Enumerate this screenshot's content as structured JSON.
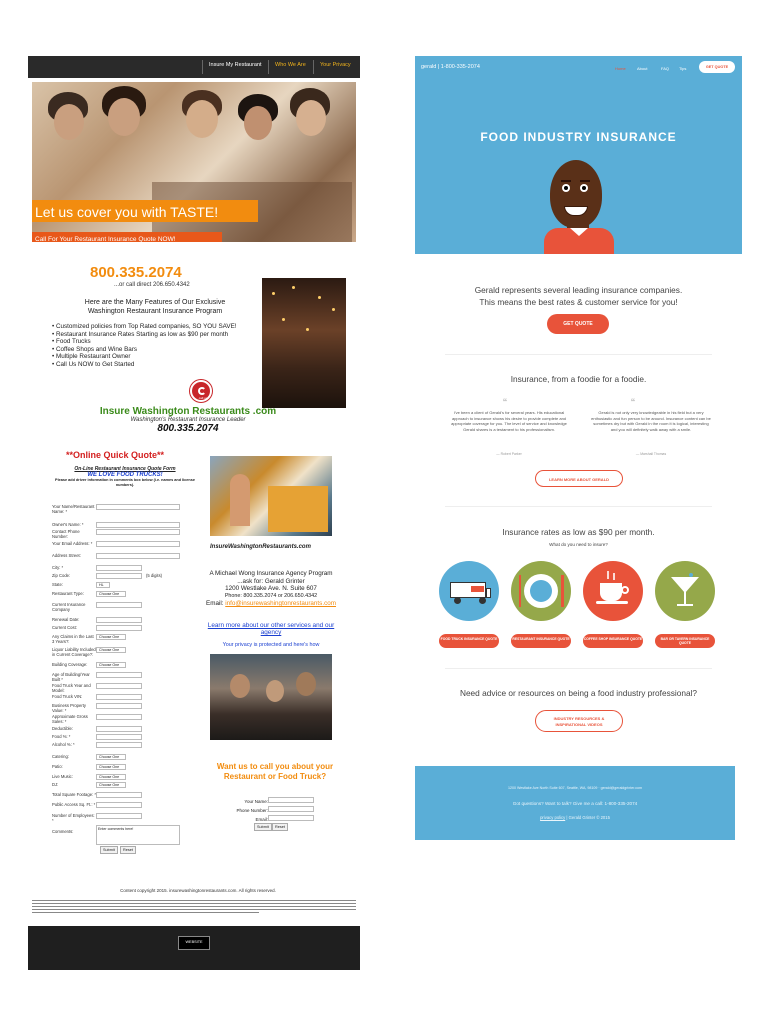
{
  "left_site": {
    "nav": {
      "items": [
        "Insure My Restaurant",
        "Who We Are",
        "Your Privacy"
      ],
      "colors": [
        "#ffffff",
        "#f2b41c",
        "#f2b41c"
      ]
    },
    "hero": {
      "tagline": "Let us cover you with TASTE!",
      "cta": "Call For Your Restaurant Insurance Quote NOW!"
    },
    "contact": {
      "phone_main": "800.335.2074",
      "phone_alt": "...or call direct 206.650.4342",
      "features_heading_1": "Here are the Many Features of Our Exclusive",
      "features_heading_2": "Washington Restaurant Insurance Program",
      "features": [
        "Customized policies from Top Rated companies, SO YOU SAVE!",
        "Restaurant Insurance Rates Starting as low as $90 per month",
        "Food Trucks",
        "Coffee Shops and Wine Bars",
        "Multiple Restaurant Owner",
        "Call Us NOW to Get Started"
      ],
      "badge_text": "call us"
    },
    "brand": {
      "name": "Insure Washington Restaurants .com",
      "subtitle": "Washington's Restaurant Insurance Leader",
      "phone": "800.335.2074"
    },
    "quote_form": {
      "heading": "**Online Quick Quote**",
      "subheading": "On-Line Restaurant Insurance Quote Form",
      "slogan": "WE LOVE FOOD TRUCKS!",
      "note": "Please add driver information in comments box below (i.e. names and license numbers).",
      "fields": [
        "Your Name/Restaurant Name: *",
        "Owner's Name: *",
        "Contact Phone Number:",
        "Your Email Address: *",
        "Address Street:",
        "City: *",
        "Zip Code:",
        "State:",
        "Restaurant Type:",
        "Current Insurance Company",
        "Renewal Date:",
        "Current Cost:",
        "Any Claims in the Last 3 Years?:",
        "Liquor Liability Included in Current Coverage?:",
        "Building Coverage:",
        "Age of Building/Year Built *",
        "Food Truck Year and Model:",
        "Food Truck VIN:",
        "Business Property Value: *",
        "Approximate Gross Sales: *",
        "Deductible:",
        "Food %: *",
        "Alcohol %: *",
        "Catering:",
        "Patio:",
        "Live Music:",
        "DJ:",
        "Total Square Footage: *",
        "Public Access Sq. Ft.: *",
        "Number of Employees: *",
        "Comments:"
      ],
      "select_placeholder": "Choose One",
      "zip_hint": "(5 digits)",
      "state_value": "HL",
      "comment_placeholder": "Enter comments here!",
      "submit": "Submit",
      "reset": "Reset"
    },
    "sidebar": {
      "site_caption": "InsureWashingtonRestaurants.com",
      "program_1": "A Michael Wong Insurance Agency Program",
      "program_2": "...ask for: Gerald Grinter",
      "address": "1200 Westlake Ave. N. Suite 607",
      "phones": "Phone: 800.335.2074 or 206.650.4342",
      "email_label": "Email:",
      "email": "info@insurewashingtonrestaurants.com",
      "learn_more": "Learn more about our other services and our agency",
      "privacy": "Your privacy is protected and here's how"
    },
    "callback": {
      "heading": "Want us to call you about your Restaurant or Food Truck?",
      "fields": [
        "Your Name:",
        "Phone Number:",
        "Email:"
      ],
      "submit": "Submit",
      "reset": "Reset"
    },
    "footer": {
      "copyright": "Content copyright 2015. insurewashingtonrestaurants.com. All rights reserved.",
      "badge": "WEBSITE"
    }
  },
  "right_site": {
    "brand": "gerald | 1-800-335-2074",
    "nav": [
      "Home",
      "About",
      "FAQ",
      "Tips"
    ],
    "get_quote_top": "GET QUOTE",
    "title": "FOOD INDUSTRY INSURANCE",
    "intro_1": "Gerald represents several leading insurance companies.",
    "intro_2": "This means the best rates & customer service for you!",
    "get_quote": "GET QUOTE",
    "foodie_heading": "Insurance, from a foodie for a foodie.",
    "testimonials": [
      {
        "text": "I've been a client of Gerald's for several years. His educational approach to insurance shows his desire to provide complete and appropriate coverage for you. The level of service and knowledge Gerald shares is a testament to his professionalism.",
        "author": "— Robert Parker"
      },
      {
        "text": "Gerald is not only very knowledgeable in his field but a very enthusiastic and fun person to be around. Insurance content can be sometimes dry but with Gerald in the room it is logical, interesting and you will definitely walk away with a smile.",
        "author": "— Marshall Thomas"
      }
    ],
    "learn_more": "LEARN MORE ABOUT GERALD",
    "rates_heading": "Insurance rates as low as $90 per month.",
    "rates_sub": "What do you need to insure?",
    "categories": [
      {
        "label": "FOOD TRUCK INSURANCE QUOTE",
        "icon": "food-truck-icon",
        "color": "#5aaed7"
      },
      {
        "label": "RESTAURANT INSURANCE QUOTE",
        "icon": "plate-icon",
        "color": "#95a84a"
      },
      {
        "label": "COFFEE SHOP INSURANCE QUOTE",
        "icon": "coffee-cup-icon",
        "color": "#e8533a"
      },
      {
        "label": "BAR OR TAVERN INSURANCE QUOTE",
        "icon": "martini-icon",
        "color": "#95a84a"
      }
    ],
    "advice_heading": "Need advice or resources on being a food industry professional?",
    "resources_btn": "INDUSTRY RESOURCES & INSPIRATIONAL VIDEOS",
    "footer": {
      "address": "1200 Westlake Ave North Suite 607, Seattle, WA, 98109 · gerald@geraldgrinter.com",
      "questions": "Got questions? Want to talk? Give me a call: 1-800-335-2074",
      "legal_link": "privacy policy",
      "legal_rest": "| Gerald Grinter © 2015"
    },
    "colors": {
      "accent": "#e8533a",
      "sky": "#5aaed7",
      "olive": "#95a84a"
    }
  }
}
